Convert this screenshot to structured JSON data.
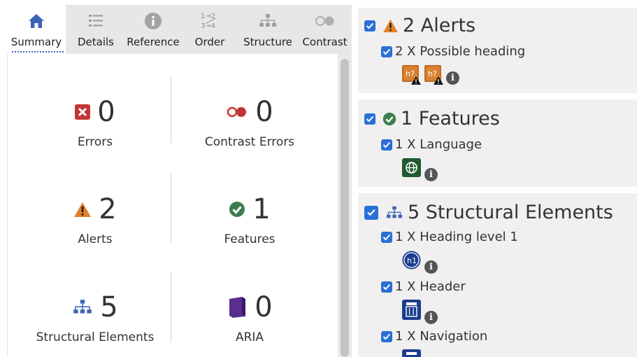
{
  "tabs": [
    {
      "label": "Summary",
      "icon": "home-icon",
      "active": true
    },
    {
      "label": "Details",
      "icon": "list-icon",
      "active": false
    },
    {
      "label": "Reference",
      "icon": "info-icon",
      "active": false
    },
    {
      "label": "Order",
      "icon": "order-arrows-icon",
      "active": false
    },
    {
      "label": "Structure",
      "icon": "hierarchy-icon",
      "active": false
    },
    {
      "label": "Contrast",
      "icon": "contrast-icon",
      "active": false
    }
  ],
  "summary": {
    "errors": {
      "count": "0",
      "label": "Errors"
    },
    "contrast_errors": {
      "count": "0",
      "label": "Contrast Errors"
    },
    "alerts": {
      "count": "2",
      "label": "Alerts"
    },
    "features": {
      "count": "1",
      "label": "Features"
    },
    "structural": {
      "count": "5",
      "label": "Structural Elements"
    },
    "aria": {
      "count": "0",
      "label": "ARIA"
    }
  },
  "details": {
    "alerts": {
      "title": "2 Alerts",
      "items": [
        {
          "label": "2 X Possible heading",
          "badge": "h?"
        }
      ]
    },
    "features": {
      "title": "1 Features",
      "items": [
        {
          "label": "1 X Language"
        }
      ]
    },
    "structure": {
      "title": "5 Structural Elements",
      "items": [
        {
          "label": "1 X Heading level 1",
          "badge": "h1"
        },
        {
          "label": "1 X Header"
        },
        {
          "label": "1 X Navigation"
        }
      ]
    }
  },
  "colors": {
    "accent": "#3b64b5",
    "error": "#c33535",
    "alert": "#e0802a",
    "feature": "#3d7d4d",
    "aria": "#5a2d91",
    "checkbox": "#2a6fd6"
  }
}
